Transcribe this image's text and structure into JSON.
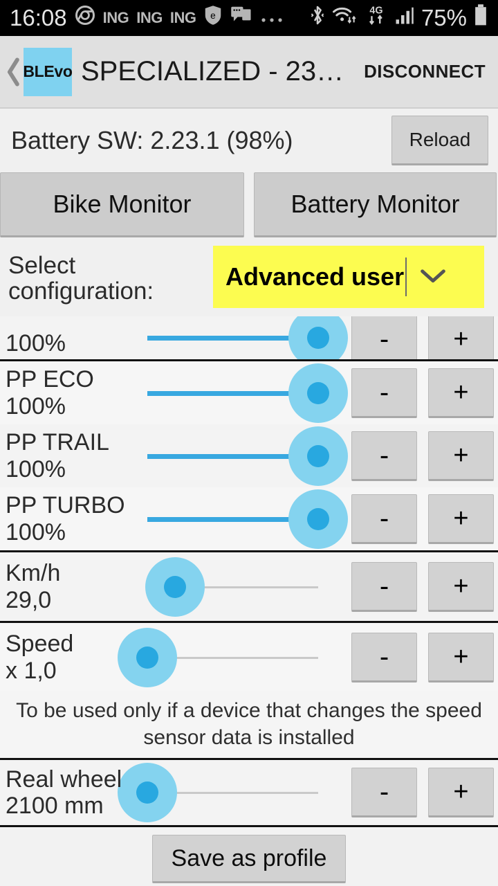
{
  "status_bar": {
    "time": "16:08",
    "app_badges": [
      "ING",
      "ING",
      "ING"
    ],
    "icons": [
      "chrome-icon",
      "shield-e-icon",
      "chat-icon",
      "overflow-dots-icon",
      "bluetooth-icon",
      "wifi-icon",
      "mobile-data-4g-icon",
      "signal-bars-icon",
      "battery-icon"
    ],
    "network_type": "4G",
    "battery_percent": "75%"
  },
  "app_bar": {
    "back_label": "❮",
    "logo_text": "BLEvo",
    "title": "SPECIALIZED - 23…",
    "disconnect_label": "DISCONNECT"
  },
  "battery_row": {
    "label": "Battery SW:  2.23.1  (98%)",
    "reload_label": "Reload"
  },
  "monitors": {
    "bike_label": "Bike Monitor",
    "battery_label": "Battery Monitor"
  },
  "config": {
    "label_line1": "Select",
    "label_line2": "configuration:",
    "selected": "Advanced user",
    "caret": "chevron-down-icon",
    "highlight_color": "#fcfc50"
  },
  "controls": {
    "minus_label": "-",
    "plus_label": "+",
    "accent_color": "#28a8e0",
    "halo_color": "#84d3ef"
  },
  "rows": [
    {
      "name": "",
      "value": "100%",
      "percent": 100,
      "clipped": true
    },
    {
      "name": "PP ECO",
      "value": "100%",
      "percent": 100,
      "clipped": false
    },
    {
      "name": "PP TRAIL",
      "value": "100%",
      "percent": 100,
      "clipped": false
    },
    {
      "name": "PP TURBO",
      "value": "100%",
      "percent": 100,
      "clipped": false
    },
    {
      "name": "Km/h",
      "value": "29,0",
      "percent": 16,
      "clipped": false
    },
    {
      "name": "Speed",
      "value": "x 1,0",
      "percent": 0,
      "clipped": false
    },
    {
      "name": "Real wheel",
      "value": "2100 mm",
      "percent": 0,
      "clipped": false
    }
  ],
  "helper_text": "To be used only if a device that changes the speed sensor data is installed",
  "footer": {
    "save_label": "Save as profile"
  }
}
